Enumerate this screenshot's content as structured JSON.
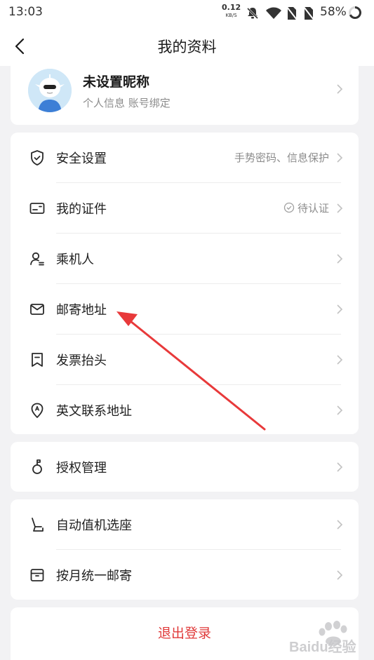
{
  "status_bar": {
    "time": "13:03",
    "net_speed": "0.12",
    "net_speed_unit": "KB/S",
    "battery": "58%",
    "icons": [
      "mute-bell-icon",
      "wifi-icon",
      "no-sim-icon",
      "no-sim-icon",
      "battery-ring-icon"
    ]
  },
  "nav": {
    "title": "我的资料",
    "back_icon": "chevron-left-icon"
  },
  "profile": {
    "nickname": "未设置昵称",
    "subtitle": "个人信息 账号绑定"
  },
  "section_main": [
    {
      "icon": "shield-icon",
      "label": "安全设置",
      "value": "手势密码、信息保护"
    },
    {
      "icon": "id-card-icon",
      "label": "我的证件",
      "value": "待认证",
      "value_icon": "check-circle-icon"
    },
    {
      "icon": "passenger-icon",
      "label": "乘机人",
      "value": ""
    },
    {
      "icon": "mail-icon",
      "label": "邮寄地址",
      "value": ""
    },
    {
      "icon": "bookmark-icon",
      "label": "发票抬头",
      "value": ""
    },
    {
      "icon": "location-pin-icon",
      "label": "英文联系地址",
      "value": ""
    }
  ],
  "section_auth": [
    {
      "icon": "key-icon",
      "label": "授权管理",
      "value": ""
    }
  ],
  "section_seat": [
    {
      "icon": "seat-icon",
      "label": "自动值机选座",
      "value": ""
    },
    {
      "icon": "box-icon",
      "label": "按月统一邮寄",
      "value": ""
    }
  ],
  "logout": {
    "label": "退出登录"
  },
  "watermark": {
    "text": "Baidu经验"
  },
  "colors": {
    "background": "#f2f2f4",
    "logout_red": "#e03a3a",
    "annotation_arrow": "#e8393a"
  }
}
